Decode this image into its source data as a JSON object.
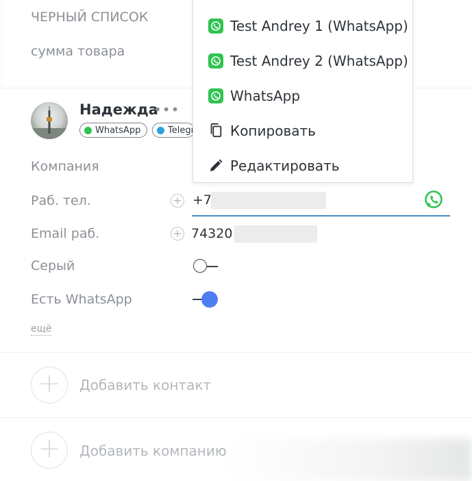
{
  "top_fields": {
    "blacklist_label": "ЧЕРНЫЙ СПИСОК",
    "product_sum_label": "сумма товара"
  },
  "contact": {
    "name": "Надежда",
    "more_label": "•••",
    "chips": [
      {
        "label": "WhatsApp",
        "color": "#2fc350",
        "icon": "whatsapp-icon"
      },
      {
        "label": "Telegram",
        "color": "#2aa3e0",
        "icon": "telegram-icon"
      }
    ],
    "fields": {
      "company_label": "Компания",
      "work_phone_label": "Раб. тел.",
      "work_phone_value": "+7",
      "work_email_label": "Email раб.",
      "work_email_value": "74320",
      "gray_label": "Серый",
      "gray_toggle": false,
      "has_whatsapp_label": "Есть WhatsApp",
      "has_whatsapp_toggle": true
    },
    "more_link": "ещё"
  },
  "actions": {
    "add_contact": "Добавить контакт",
    "add_company": "Добавить компанию"
  },
  "menu": {
    "items": [
      {
        "label": "Test Andrey 1 (WhatsApp)",
        "icon": "whatsapp-icon"
      },
      {
        "label": "Test Andrey 2 (WhatsApp)",
        "icon": "whatsapp-icon"
      },
      {
        "label": "WhatsApp",
        "icon": "whatsapp-icon"
      },
      {
        "label": "Копировать",
        "icon": "copy-icon"
      },
      {
        "label": "Редактировать",
        "icon": "pencil-icon"
      }
    ]
  },
  "colors": {
    "whatsapp_green": "#2fc350",
    "toggle_on": "#4f7df2",
    "input_underline": "#4a8bc4",
    "telegram_blue": "#2aa3e0"
  }
}
